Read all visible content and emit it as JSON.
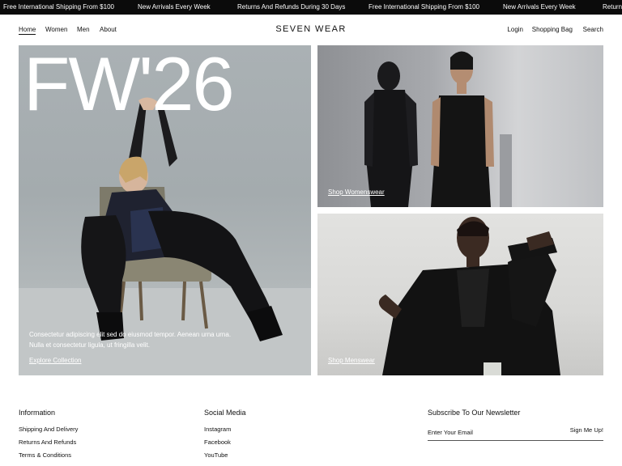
{
  "announcements": [
    "Free International Shipping From $100",
    "New Arrivals Every Week",
    "Returns And Refunds During 30 Days",
    "Free International Shipping From $100",
    "New Arrivals Every Week",
    "Returns"
  ],
  "header": {
    "nav_left": [
      "Home",
      "Women",
      "Men",
      "About"
    ],
    "logo": "SEVEN WEAR",
    "nav_right": [
      "Login",
      "Shopping Bag",
      "Search"
    ]
  },
  "hero": {
    "main": {
      "title": "FW'26",
      "copy": "Consectetur adipiscing elit sed do eiusmod tempor. Aenean urna urna. Nulla et consectetur ligula, ut fringilla velit.",
      "link": "Explore Collection"
    },
    "women": {
      "link": "Shop Womenswear"
    },
    "men": {
      "link": "Shop Menswear"
    }
  },
  "footer": {
    "information": {
      "heading": "Information",
      "links": [
        "Shipping And Delivery",
        "Returns And Refunds",
        "Terms & Conditions"
      ]
    },
    "social": {
      "heading": "Social Media",
      "links": [
        "Instagram",
        "Facebook",
        "YouTube"
      ]
    },
    "newsletter": {
      "heading": "Subscribe To Our Newsletter",
      "placeholder": "Enter Your Email",
      "button": "Sign Me Up!"
    }
  }
}
